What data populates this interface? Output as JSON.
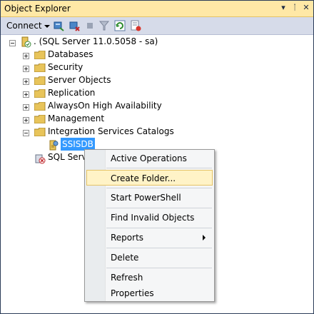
{
  "window": {
    "title": "Object Explorer",
    "pin_glyph": "▾",
    "autohide_glyph": "ᛙ",
    "close_glyph": "✕"
  },
  "toolbar": {
    "connect_label": "Connect"
  },
  "tree": {
    "server": ". (SQL Server 11.0.5058 - sa)",
    "nodes": [
      "Databases",
      "Security",
      "Server Objects",
      "Replication",
      "AlwaysOn High Availability",
      "Management",
      "Integration Services Catalogs"
    ],
    "catalog_child": "SSISDB",
    "agent_partial": "SQL Serve"
  },
  "context_menu": {
    "items": [
      "Active Operations",
      "Create Folder...",
      "Start PowerShell",
      "Find Invalid Objects",
      "Reports",
      "Delete",
      "Refresh",
      "Properties"
    ],
    "highlighted": "Create Folder..."
  },
  "colors": {
    "title_bar": "#ffe8a6",
    "toolbar": "#d6dbe9",
    "selection": "#3399ff",
    "menu_highlight": "#fff3c7",
    "folder": "#e8c45a"
  }
}
